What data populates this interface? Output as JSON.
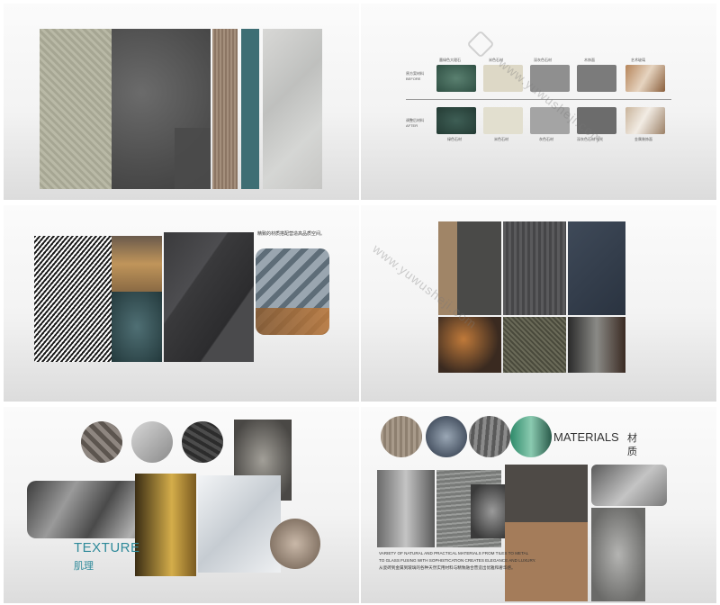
{
  "slide2": {
    "row_before_label": "原方案材料 BEFORE",
    "row_after_label": "调整后材料 AFTER",
    "col_labels": [
      "墨绿色大理石",
      "米色石材",
      "深灰色石材",
      "木饰面",
      "艺术玻璃"
    ],
    "after_labels": [
      "绿色石材",
      "米色石材",
      "灰色石材",
      "深灰色石材 哑光",
      "金属装饰面"
    ]
  },
  "slide3": {
    "caption": "精致的材质搭配营造高品质空间。"
  },
  "slide5": {
    "title": "TEXTURE",
    "subtitle": "肌理"
  },
  "slide6": {
    "title": "MATERIALS",
    "title_cn": "材质",
    "desc_line1": "VARIETY OF NATURAL AND PRACTICAL MATERIALS FROM TILES TO METAL",
    "desc_line2": "TO GLASS FUSING WITH SOPHISTICATION CREATES ELEGANCE AND LUXURY.",
    "desc_line3": "从瓷砖到金属到玻璃的各种天然实用材料与精致融合营造出优雅和奢华感。"
  },
  "watermark": {
    "text": "www.yuwusheji.com",
    "logo_text": "语物设计"
  },
  "colors": {
    "slide_bg_top": "#fbfbfb",
    "slide_bg_bottom": "#dcdcdc",
    "teal_accent": "#3e6e74",
    "texture_title": "#2f8a9a"
  }
}
